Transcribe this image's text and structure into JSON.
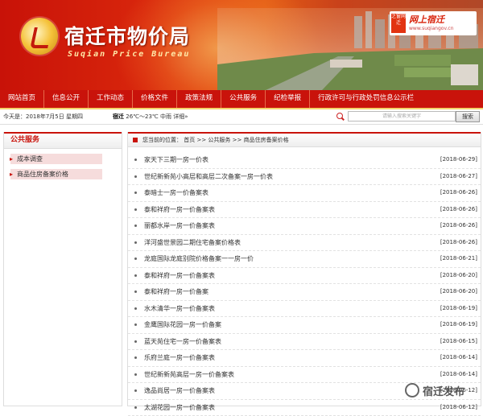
{
  "header": {
    "title": "宿迁市物价局",
    "subtitle": "Suqian Price Bureau",
    "badge_tag": "之窗网迁",
    "badge_text": "网上宿迁",
    "badge_url": "www.suqiangov.cn"
  },
  "nav": [
    "网站首页",
    "信息公开",
    "工作动态",
    "价格文件",
    "政策法规",
    "公共服务",
    "纪检举报",
    "行政许可与行政处罚信息公示栏"
  ],
  "topbar": {
    "date": "今天是：2018年7月5日  星期四",
    "weather_city": "宿迁",
    "weather": "26℃～23℃ 中雨 详细»",
    "search_placeholder": "请输入搜索关键字",
    "search_button": "搜索"
  },
  "sidebar": {
    "title": "公共服务",
    "items": [
      "成本调查",
      "商品住房备案价格"
    ]
  },
  "breadcrumb": "您当前的位置：  首页  >>  公共服务  >>  商品住房备案价格",
  "list": [
    {
      "title": "家天下三期一房一价表",
      "date": "[2018-06-29]"
    },
    {
      "title": "世纪新新苑小高层和高层二次备案一房一价表",
      "date": "[2018-06-27]"
    },
    {
      "title": "泰暗士一房一价备案表",
      "date": "[2018-06-26]"
    },
    {
      "title": "泰和祥府一房一价备案表",
      "date": "[2018-06-26]"
    },
    {
      "title": "丽都水岸一房一价备案表",
      "date": "[2018-06-26]"
    },
    {
      "title": "洋河盛世景园二期住宅备案价格表",
      "date": "[2018-06-26]"
    },
    {
      "title": "龙庭国际龙庭别院价格备案一一房一价",
      "date": "[2018-06-21]"
    },
    {
      "title": "泰和祥府一房一价备案表",
      "date": "[2018-06-20]"
    },
    {
      "title": "泰和祥府一房一价备案",
      "date": "[2018-06-20]"
    },
    {
      "title": "水木清华一房一价备案表",
      "date": "[2018-06-19]"
    },
    {
      "title": "金鹰国际花园一房一价备案",
      "date": "[2018-06-19]"
    },
    {
      "title": "蓝天苑住宅一房一价备案表",
      "date": "[2018-06-15]"
    },
    {
      "title": "乐府兰庭一房一价备案表",
      "date": "[2018-06-14]"
    },
    {
      "title": "世纪新新苑高层一房一价备案表",
      "date": "[2018-06-14]"
    },
    {
      "title": "逸品尚居一房一价备案表",
      "date": "[2018-06-12]"
    },
    {
      "title": "太湖花园一房一价备案表",
      "date": "[2018-06-12]"
    }
  ],
  "watermark": "宿迁发布"
}
